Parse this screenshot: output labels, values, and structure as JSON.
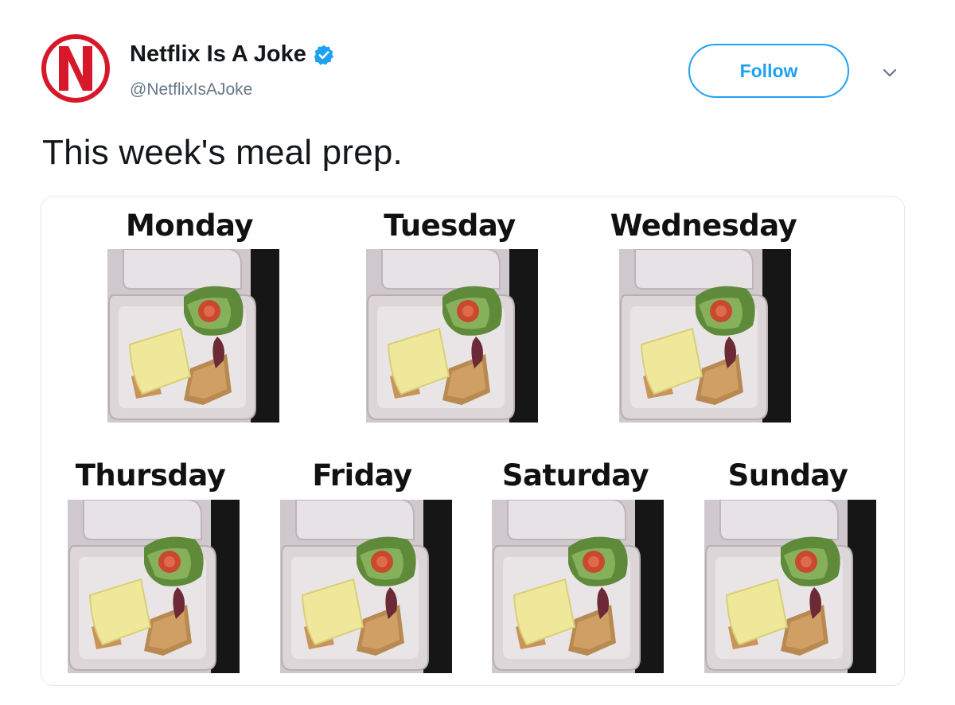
{
  "author": {
    "display_name": "Netflix Is A Joke",
    "handle": "@NetflixIsAJoke",
    "verified": true,
    "avatar_letter": "N"
  },
  "actions": {
    "follow_label": "Follow",
    "more_icon": "chevron-down-icon"
  },
  "tweet": {
    "text": "This week's meal prep."
  },
  "meal_plan": {
    "days": [
      "Monday",
      "Tuesday",
      "Wednesday",
      "Thursday",
      "Friday",
      "Saturday",
      "Sunday"
    ]
  },
  "colors": {
    "brand_red": "#d7182a",
    "twitter_blue": "#1da1f2",
    "handle_gray": "#657786"
  }
}
